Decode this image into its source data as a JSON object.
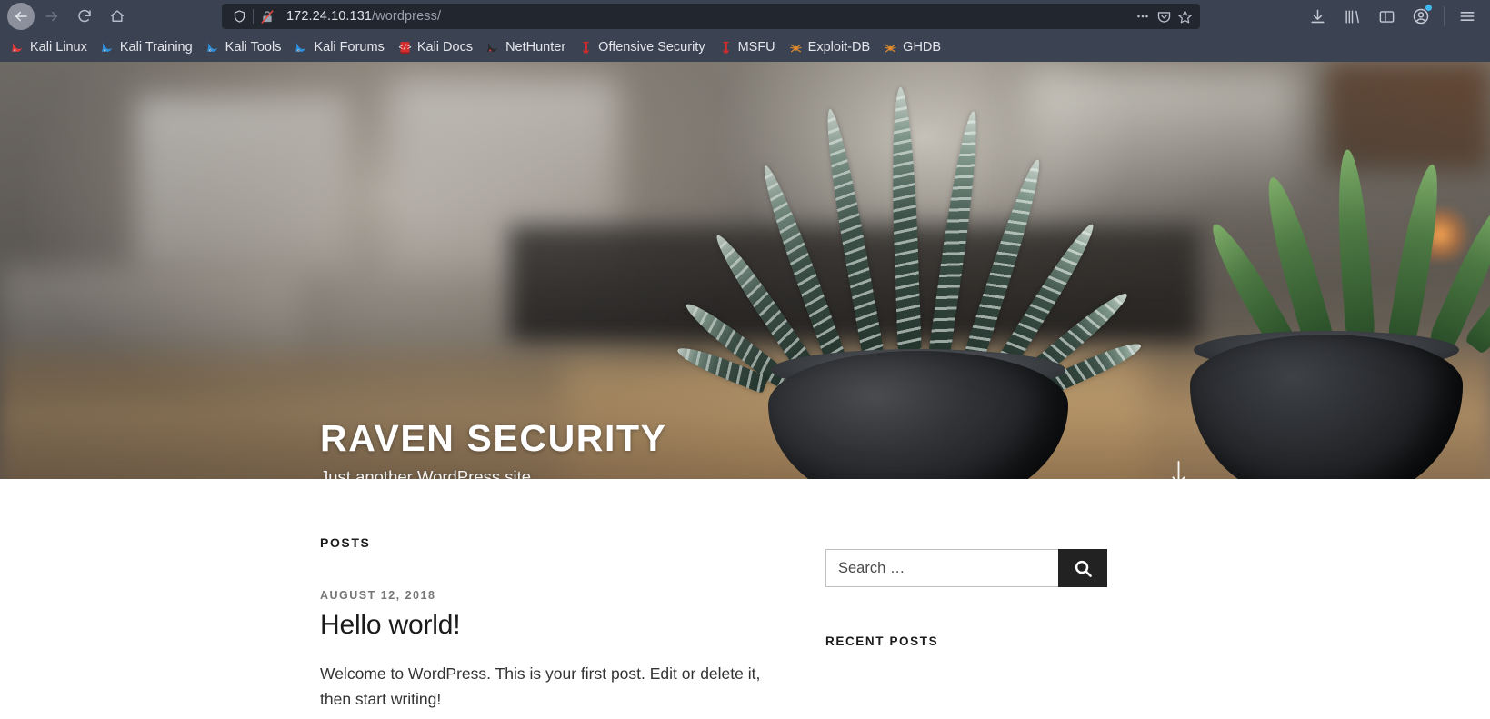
{
  "browser": {
    "nav": {
      "back_label": "Back",
      "forward_label": "Forward",
      "reload_label": "Reload",
      "home_label": "Home"
    },
    "urlbar": {
      "shield_icon": "shield-icon",
      "security_icon": "crossed-padlock-icon",
      "host": "172.24.10.131",
      "path": "/wordpress/",
      "page_actions_icon": "ellipsis-icon",
      "pocket_icon": "pocket-icon",
      "bookmark_icon": "star-icon"
    },
    "toolbar_right": [
      {
        "name": "downloads-icon",
        "label": "Downloads"
      },
      {
        "name": "library-icon",
        "label": "Library"
      },
      {
        "name": "sidebar-icon",
        "label": "Sidebars"
      },
      {
        "name": "account-icon",
        "label": "Account",
        "badge": true
      },
      {
        "name": "menu-icon",
        "label": "Open menu"
      }
    ],
    "bookmarks": [
      {
        "label": "Kali Linux",
        "icon": "kali-dragon-red-icon"
      },
      {
        "label": "Kali Training",
        "icon": "kali-dragon-blue-icon"
      },
      {
        "label": "Kali Tools",
        "icon": "kali-dragon-blue-icon"
      },
      {
        "label": "Kali Forums",
        "icon": "kali-dragon-blue-icon"
      },
      {
        "label": "Kali Docs",
        "icon": "red-book-icon"
      },
      {
        "label": "NetHunter",
        "icon": "kali-dragon-dark-icon"
      },
      {
        "label": "Offensive Security",
        "icon": "red-pillar-icon"
      },
      {
        "label": "MSFU",
        "icon": "red-pillar-icon"
      },
      {
        "label": "Exploit-DB",
        "icon": "orange-spider-icon"
      },
      {
        "label": "GHDB",
        "icon": "orange-spider-icon"
      }
    ]
  },
  "site": {
    "title": "RAVEN SECURITY",
    "description": "Just another WordPress site",
    "scroll_icon": "down-arrow-icon"
  },
  "main": {
    "posts_label": "Posts",
    "posts": [
      {
        "date": "August 12, 2018",
        "title": "Hello world!",
        "excerpt": "Welcome to WordPress. This is your first post. Edit or delete it, then start writing!"
      }
    ]
  },
  "sidebar": {
    "search": {
      "placeholder": "Search …",
      "value": "",
      "button_icon": "search-icon"
    },
    "recent_posts_label": "Recent Posts"
  },
  "colors": {
    "chrome_bg": "#3b4252",
    "urlbar_bg": "#22262f",
    "accent_blue": "#3fb7f0",
    "kali_red": "#e03a3a",
    "kali_blue": "#2f8fd8",
    "exploit_orange": "#e08a2e",
    "search_button_bg": "#222222",
    "text_dark": "#1a1a1a",
    "text_muted": "#767676"
  }
}
